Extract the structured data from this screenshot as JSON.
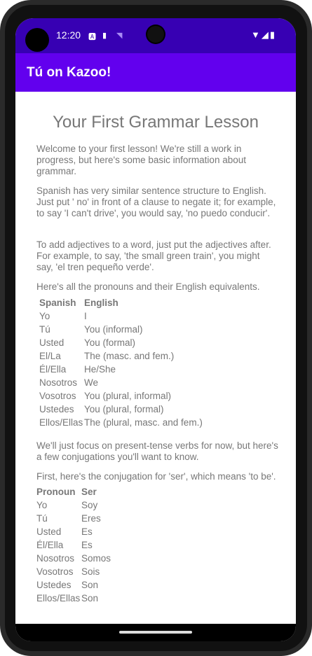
{
  "status_bar": {
    "time": "12:20",
    "icons": [
      "notification-a-icon",
      "sd-card-icon",
      "wifi-question-icon",
      "wifi-icon",
      "signal-icon",
      "battery-icon"
    ]
  },
  "app_bar": {
    "title": "Tú on Kazoo!"
  },
  "lesson": {
    "heading": "Your First Grammar Lesson",
    "p1": "Welcome to your first lesson! We're still a work in progress, but here's some basic information about grammar.",
    "p2": "Spanish has very similar sentence structure to English. Just put ' no' in front of a clause to negate it; for example, to say 'I can't drive', you would say, 'no puedo conducir'.",
    "p3": "To add adjectives to a word, just put the adjectives after. For example, to say, 'the small green train', you might say, 'el tren pequeño verde'.",
    "p4": "Here's all the pronouns and their English equivalents.",
    "pronouns": {
      "headers": [
        "Spanish",
        "English"
      ],
      "rows": [
        [
          "Yo",
          "I"
        ],
        [
          "Tú",
          "You (informal)"
        ],
        [
          "Usted",
          "You (formal)"
        ],
        [
          "El/La",
          "The (masc. and fem.)"
        ],
        [
          "Él/Ella",
          "He/She"
        ],
        [
          "Nosotros",
          "We"
        ],
        [
          "Vosotros",
          "You (plural, informal)"
        ],
        [
          "Ustedes",
          "You (plural, formal)"
        ],
        [
          "Ellos/Ellas",
          "The (plural, masc. and fem.)"
        ]
      ]
    },
    "p5": "We'll just focus on present-tense verbs for now, but here's a few conjugations you'll want to know.",
    "p6": "First, here's the conjugation for 'ser', which means 'to be'.",
    "ser": {
      "headers": [
        "Pronoun",
        "Ser"
      ],
      "rows": [
        [
          "Yo",
          "Soy"
        ],
        [
          "Tú",
          "Eres"
        ],
        [
          "Usted",
          "Es"
        ],
        [
          "Él/Ella",
          "Es"
        ],
        [
          "Nosotros",
          "Somos"
        ],
        [
          "Vosotros",
          "Sois"
        ],
        [
          "Ustedes",
          "Son"
        ],
        [
          "Ellos/Ellas",
          "Son"
        ]
      ]
    }
  }
}
